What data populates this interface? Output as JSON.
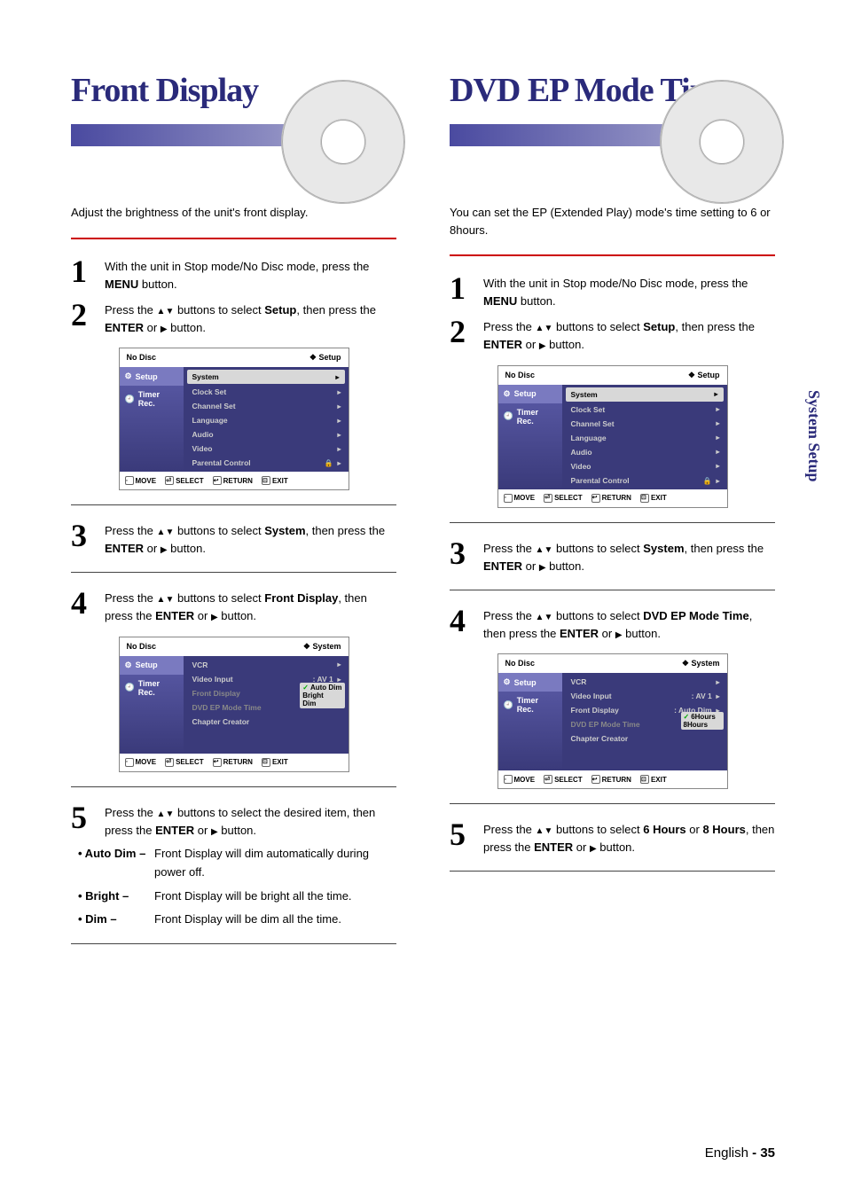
{
  "left": {
    "title": "Front Display",
    "intro": "Adjust the brightness of the unit's front display.",
    "steps": {
      "s1": "With the unit in Stop mode/No Disc mode, press the MENU button.",
      "s2": "Press the ▲▼ buttons to select Setup, then press the ENTER or ▶ button.",
      "s3": "Press the ▲▼ buttons to select System, then press the ENTER or ▶ button.",
      "s4": "Press the  ▲▼ buttons to select Front Display, then press the ENTER or ▶ button.",
      "s5": "Press the ▲▼ buttons to select the desired item, then press the ENTER or ▶ button."
    },
    "bullets": {
      "b1_label": "• Auto Dim –",
      "b1_text": "Front Display will dim automatically during power off.",
      "b2_label": "• Bright –",
      "b2_text": "Front Display will be bright all the time.",
      "b3_label": "• Dim –",
      "b3_text": "Front Display will be dim all the time."
    }
  },
  "right": {
    "title": "DVD EP Mode Time",
    "intro": "You can set the EP (Extended Play) mode's time setting to 6 or 8hours.",
    "steps": {
      "s1": "With the unit in Stop mode/No Disc mode, press the MENU button.",
      "s2": "Press the ▲▼ buttons to select Setup, then press the ENTER or ▶ button.",
      "s3": "Press the ▲▼ buttons to select System, then press the ENTER or ▶ button.",
      "s4": "Press the ▲▼ buttons to select DVD EP Mode Time, then press the ENTER or ▶ button.",
      "s5": "Press the ▲▼ buttons to select 6 Hours or 8 Hours, then press the ENTER or ▶ button."
    }
  },
  "osd_setup": {
    "top_left": "No Disc",
    "top_right": "Setup",
    "side": {
      "setup": "Setup",
      "timer": "Timer Rec."
    },
    "rows": {
      "system": "System",
      "clock": "Clock Set",
      "channel": "Channel Set",
      "language": "Language",
      "audio": "Audio",
      "video": "Video",
      "parental": "Parental Control"
    },
    "bottom": {
      "move": "MOVE",
      "select": "SELECT",
      "return": "RETURN",
      "exit": "EXIT"
    }
  },
  "osd_system_left": {
    "top_left": "No Disc",
    "top_right": "System",
    "rows": {
      "vcr": "VCR",
      "video_input": "Video Input",
      "video_input_val": ": AV 1",
      "front_display": "Front Display",
      "dvd_ep": "DVD EP Mode Time",
      "chapter": "Chapter Creator"
    },
    "popup": {
      "o1": "Auto Dim",
      "o2": "Bright",
      "o3": "Dim"
    }
  },
  "osd_system_right": {
    "rows": {
      "front_display_val": ": Auto Dim"
    },
    "popup": {
      "o1": "6Hours",
      "o2": "8Hours"
    }
  },
  "sidetab": "System Setup",
  "footer": {
    "lang": "English",
    "sep": " - ",
    "num": "35"
  }
}
